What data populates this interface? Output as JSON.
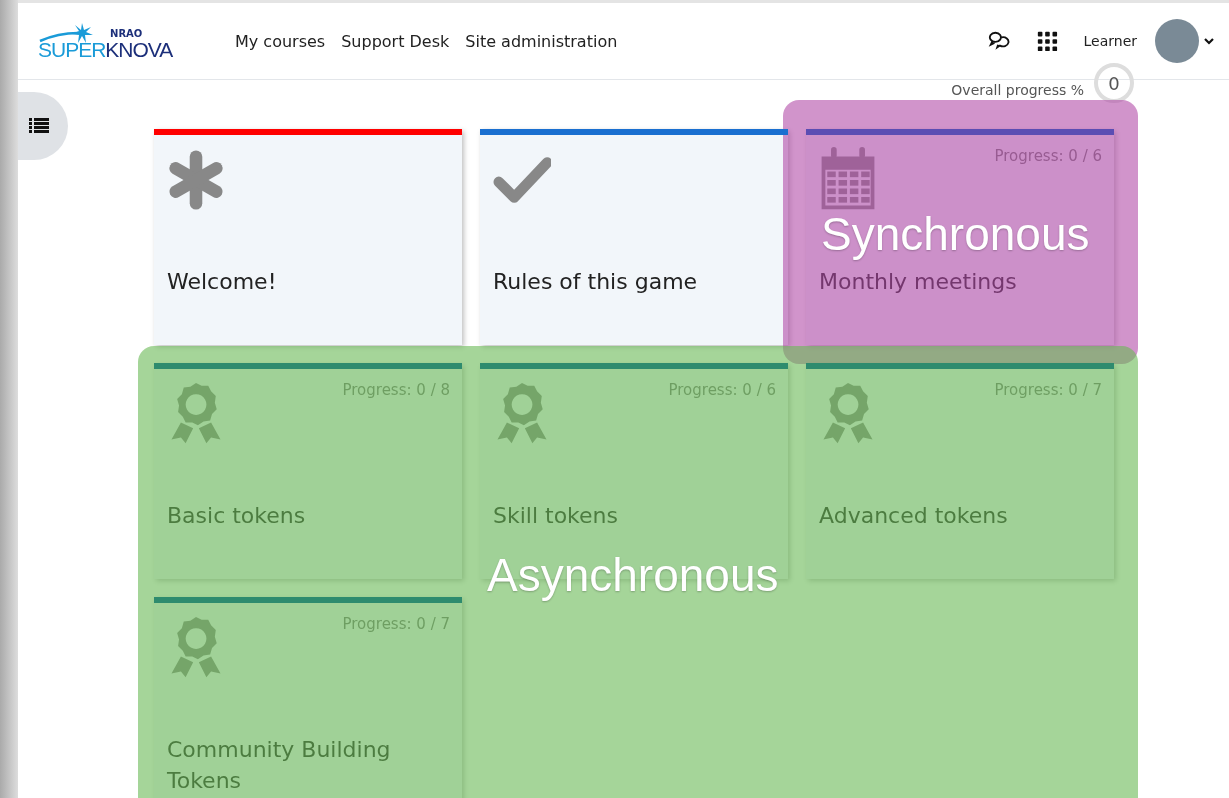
{
  "header": {
    "logo": {
      "top": "NRAO",
      "first": "SUPER",
      "second": "KNOVA"
    },
    "nav": [
      "My courses",
      "Support Desk",
      "Site administration"
    ],
    "user": "Learner"
  },
  "overall_progress": {
    "label": "Overall progress %",
    "value": "0"
  },
  "cards": [
    {
      "kind": "asterisk",
      "color": "#ff0000",
      "title": "Welcome!"
    },
    {
      "kind": "check",
      "color": "#1a6fd0",
      "title": "Rules of this game"
    },
    {
      "kind": "calendar",
      "color": "#5b4db3",
      "title": "Monthly meetings",
      "progress": "Progress: 0 / 6"
    },
    {
      "kind": "award",
      "color": "#2e8b6e",
      "title": "Basic tokens",
      "progress": "Progress: 0 / 8"
    },
    {
      "kind": "award",
      "color": "#2e8b6e",
      "title": "Skill tokens",
      "progress": "Progress: 0 / 6"
    },
    {
      "kind": "award",
      "color": "#2e8b6e",
      "title": "Advanced tokens",
      "progress": "Progress: 0 / 7"
    },
    {
      "kind": "award",
      "color": "#2e8b6e",
      "title": "Community Building Tokens",
      "progress": "Progress: 0 / 7"
    }
  ],
  "annotations": [
    {
      "kind": "sync",
      "label": "Synchronous"
    },
    {
      "kind": "async",
      "label": "Asynchronous"
    }
  ]
}
